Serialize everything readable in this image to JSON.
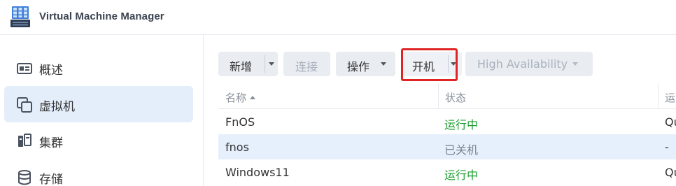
{
  "app": {
    "title": "Virtual Machine Manager",
    "icon": "vmm-grid-icon"
  },
  "sidebar": {
    "items": [
      {
        "label": "概述",
        "icon": "overview-card-icon",
        "active": false
      },
      {
        "label": "虚拟机",
        "icon": "copy-squares-icon",
        "active": true
      },
      {
        "label": "集群",
        "icon": "cluster-icon",
        "active": false
      },
      {
        "label": "存储",
        "icon": "database-icon",
        "active": false
      }
    ]
  },
  "toolbar": {
    "add_label": "新增",
    "connect_label": "连接",
    "action_label": "操作",
    "power_on_label": "开机",
    "ha_label": "High Availability"
  },
  "table": {
    "columns": [
      "名称",
      "状态",
      "运"
    ],
    "rows": [
      {
        "name": "FnOS",
        "status": "运行中",
        "extra": "Qu",
        "status_type": "running",
        "selected": false
      },
      {
        "name": "fnos",
        "status": "已关机",
        "extra": "-",
        "status_type": "off",
        "selected": true
      },
      {
        "name": "Windows11",
        "status": "运行中",
        "extra": "Qu",
        "status_type": "running",
        "selected": false
      }
    ]
  },
  "colors": {
    "accent": "#e4eefb",
    "running": "#1a9e2e",
    "highlight": "#e02424"
  }
}
